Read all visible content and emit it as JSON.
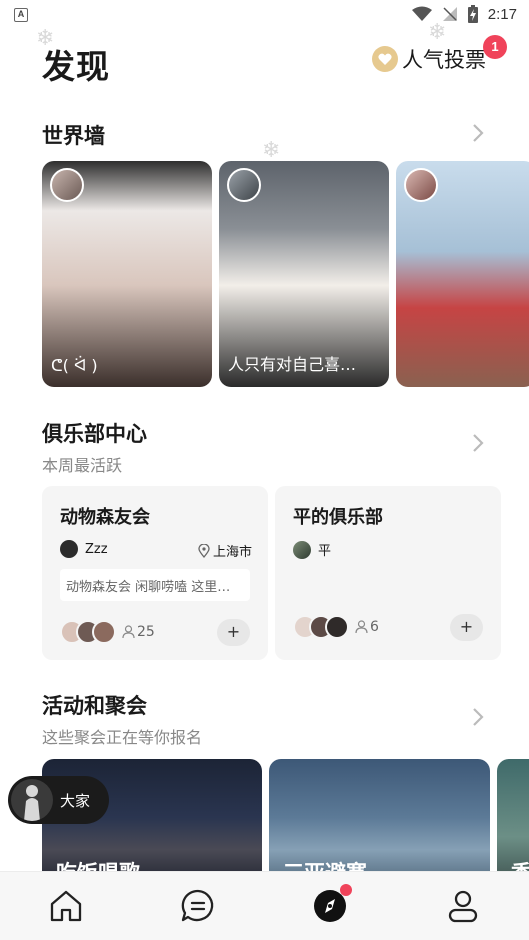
{
  "status_bar": {
    "time": "2:17",
    "app_icon": "A"
  },
  "header": {
    "title": "发现",
    "vote_label": "人气投票",
    "vote_badge": "1"
  },
  "world_wall": {
    "title": "世界墙",
    "cards": [
      {
        "caption": "ᕦ( ᐛ )",
        "colors": [
          "#3b3b3b",
          "#d7c7bf"
        ]
      },
      {
        "caption": "人只有对自己喜…",
        "colors": [
          "#5b5f66",
          "#2b2b2b"
        ]
      },
      {
        "caption": "",
        "colors": [
          "#b9cfe3",
          "#8e5f4e"
        ]
      }
    ]
  },
  "clubs": {
    "title": "俱乐部中心",
    "subtitle": "本周最活跃",
    "items": [
      {
        "name": "动物森友会",
        "owner": "Zzz",
        "location": "上海市",
        "desc": "动物森友会 闲聊唠嗑 这里…",
        "members": "25",
        "join": "+"
      },
      {
        "name": "平的俱乐部",
        "owner": "平",
        "location": "",
        "desc": "",
        "members": "6",
        "join": "+"
      }
    ]
  },
  "events": {
    "title": "活动和聚会",
    "subtitle": "这些聚会正在等你报名",
    "items": [
      {
        "title": "吃饭唱歌"
      },
      {
        "title": "三亚避寒"
      },
      {
        "title": "香"
      }
    ]
  },
  "floating": {
    "label": "大家"
  },
  "tabbar": {
    "items": [
      "home-icon",
      "chat-icon",
      "compass-icon",
      "profile-icon"
    ]
  }
}
